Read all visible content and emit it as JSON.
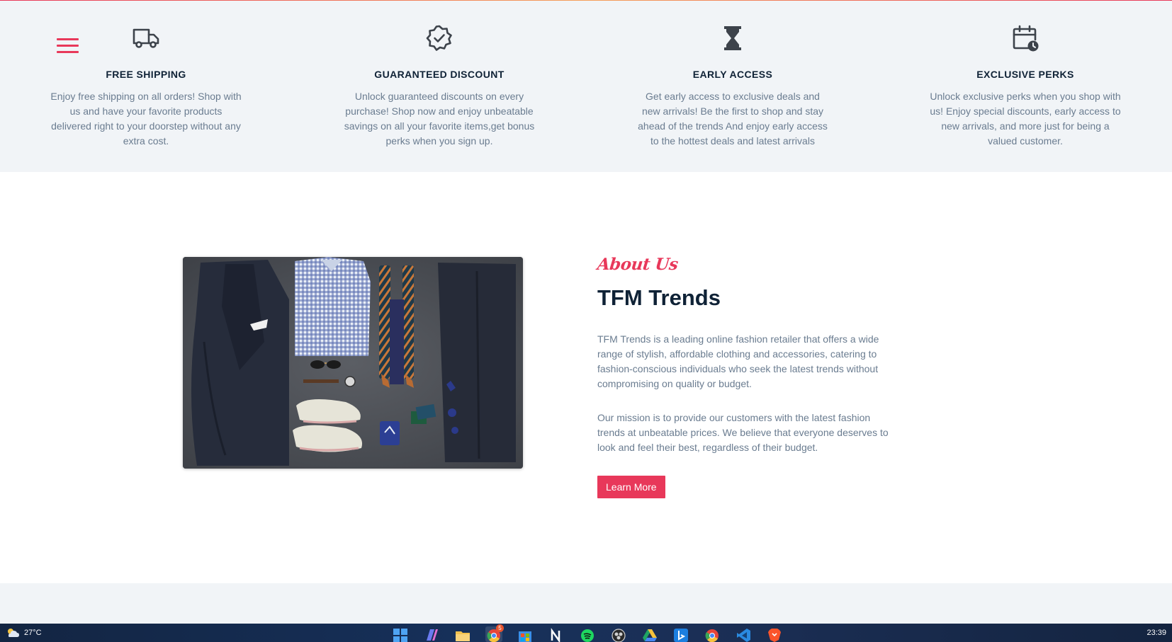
{
  "features": [
    {
      "icon": "truck-icon",
      "title": "FREE SHIPPING",
      "description": "Enjoy free shipping on all orders! Shop with us and have your favorite products delivered right to your doorstep without any extra cost."
    },
    {
      "icon": "badge-check-icon",
      "title": "GUARANTEED DISCOUNT",
      "description": "Unlock guaranteed discounts on every purchase! Shop now and enjoy unbeatable savings on all your favorite items,get bonus perks when you sign up."
    },
    {
      "icon": "hourglass-icon",
      "title": "EARLY ACCESS",
      "description": "Get early access to exclusive deals and new arrivals! Be the first to shop and stay ahead of the trends And enjoy early access to the hottest deals and latest arrivals"
    },
    {
      "icon": "calendar-clock-icon",
      "title": "EXCLUSIVE PERKS",
      "description": "Unlock exclusive perks when you shop with us! Enjoy special discounts, early access to new arrivals, and more just for being a valued customer."
    }
  ],
  "about": {
    "eyebrow": "About Us",
    "title": "TFM Trends",
    "paragraph1": "TFM Trends is a leading online fashion retailer that offers a wide range of stylish, affordable clothing and accessories, catering to fashion-conscious individuals who seek the latest trends without compromising on quality or budget.",
    "paragraph2": "Our mission is to provide our customers with the latest fashion trends at unbeatable prices. We believe that everyone deserves to look and feel their best, regardless of their budget.",
    "button_label": "Learn More"
  },
  "colors": {
    "accent": "#e8385a",
    "heading": "#0f2236",
    "body_text": "#6a7c90",
    "band_bg": "#f1f4f7"
  },
  "taskbar": {
    "temperature": "27°C",
    "time": "23:39",
    "chrome_badge": "5",
    "apps": [
      "windows-start-icon",
      "copilot-icon",
      "file-explorer-icon",
      "chrome-icon",
      "microsoft-store-icon",
      "notion-icon",
      "spotify-icon",
      "obs-icon",
      "google-drive-icon",
      "bing-icon",
      "chrome-icon",
      "vscode-icon",
      "brave-icon"
    ]
  }
}
